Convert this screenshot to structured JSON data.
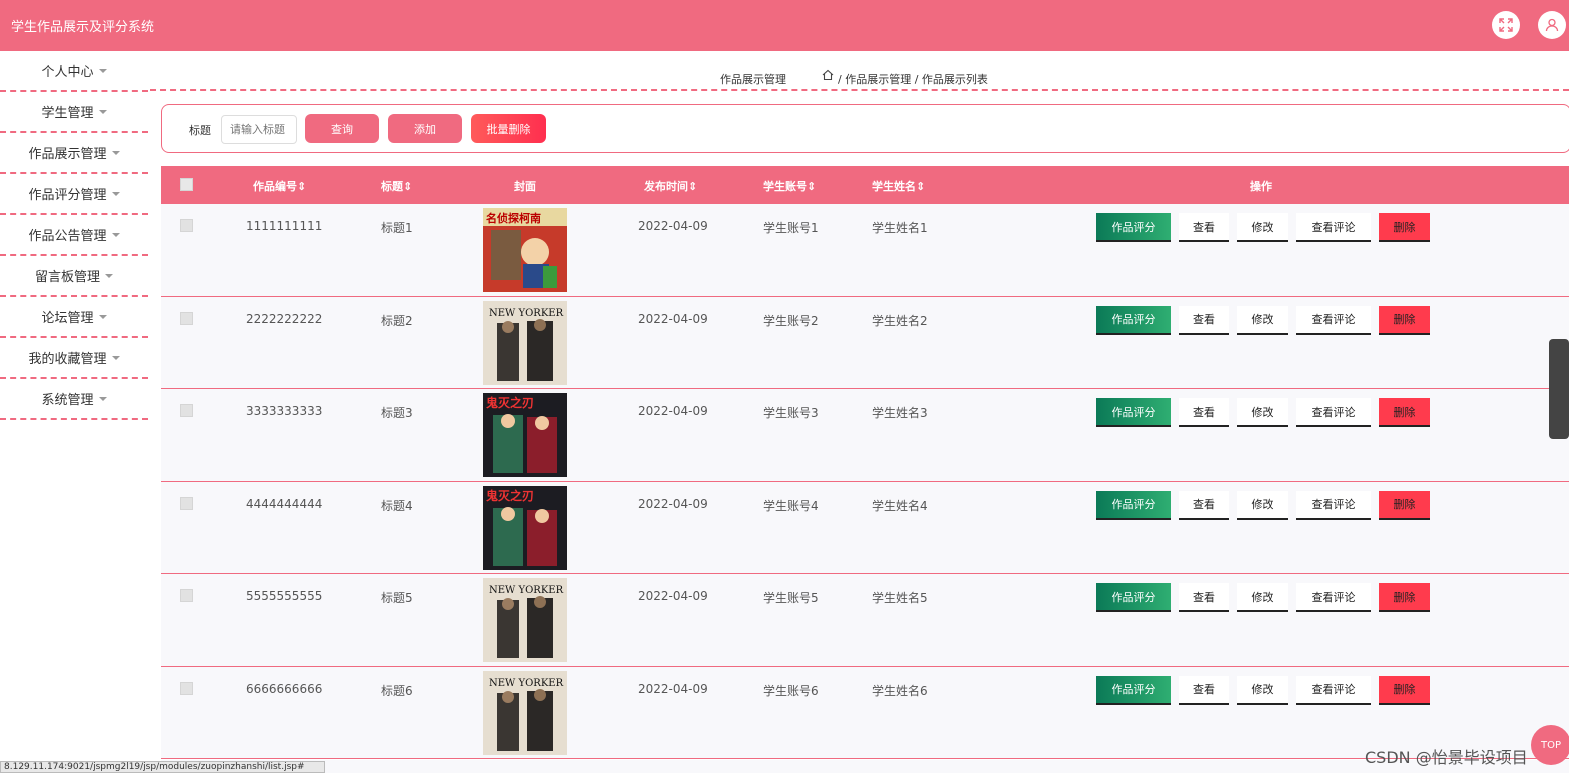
{
  "app": {
    "title": "学生作品展示及评分系统"
  },
  "header": {
    "icons": [
      "fullscreen-icon",
      "user-icon"
    ]
  },
  "sidebar": {
    "items": [
      {
        "label": "个人中心"
      },
      {
        "label": "学生管理"
      },
      {
        "label": "作品展示管理"
      },
      {
        "label": "作品评分管理"
      },
      {
        "label": "作品公告管理"
      },
      {
        "label": "留言板管理"
      },
      {
        "label": "论坛管理"
      },
      {
        "label": "我的收藏管理"
      },
      {
        "label": "系统管理"
      }
    ]
  },
  "breadcrumb": {
    "section": "作品展示管理",
    "trail": "/ 作品展示管理 / 作品展示列表"
  },
  "search": {
    "label": "标题",
    "placeholder": "请输入标题",
    "query_button": "查询",
    "add_button": "添加",
    "batch_delete_button": "批量删除"
  },
  "table": {
    "headers": {
      "id": "作品编号",
      "title": "标题",
      "cover": "封面",
      "date": "发布时间",
      "account": "学生账号",
      "name": "学生姓名",
      "actions": "操作"
    },
    "action_labels": {
      "rate": "作品评分",
      "view": "查看",
      "edit": "修改",
      "comments": "查看评论",
      "delete": "删除"
    },
    "rows": [
      {
        "id": "1111111111",
        "title": "标题1",
        "date": "2022-04-09",
        "account": "学生账号1",
        "name": "学生姓名1",
        "cover": "名侦探柯南"
      },
      {
        "id": "2222222222",
        "title": "标题2",
        "date": "2022-04-09",
        "account": "学生账号2",
        "name": "学生姓名2",
        "cover": "THE NEW YORKER"
      },
      {
        "id": "3333333333",
        "title": "标题3",
        "date": "2022-04-09",
        "account": "学生账号3",
        "name": "学生姓名3",
        "cover": "鬼灭之刃"
      },
      {
        "id": "4444444444",
        "title": "标题4",
        "date": "2022-04-09",
        "account": "学生账号4",
        "name": "学生姓名4",
        "cover": "鬼灭之刃"
      },
      {
        "id": "5555555555",
        "title": "标题5",
        "date": "2022-04-09",
        "account": "学生账号5",
        "name": "学生姓名5",
        "cover": "THE NEW YORKER"
      },
      {
        "id": "6666666666",
        "title": "标题6",
        "date": "2022-04-09",
        "account": "学生账号6",
        "name": "学生姓名6",
        "cover": "THE NEW YORKER"
      }
    ]
  },
  "status_bar": {
    "url": "8.129.11.174:9021/jspmg2l19/jsp/modules/zuopinzhanshi/list.jsp#"
  },
  "watermark": "CSDN @怡景毕设项目",
  "back_to_top": "TOP",
  "colors": {
    "primary": "#f06a80",
    "green": "#1f9a68",
    "danger": "#ff3b4d"
  }
}
